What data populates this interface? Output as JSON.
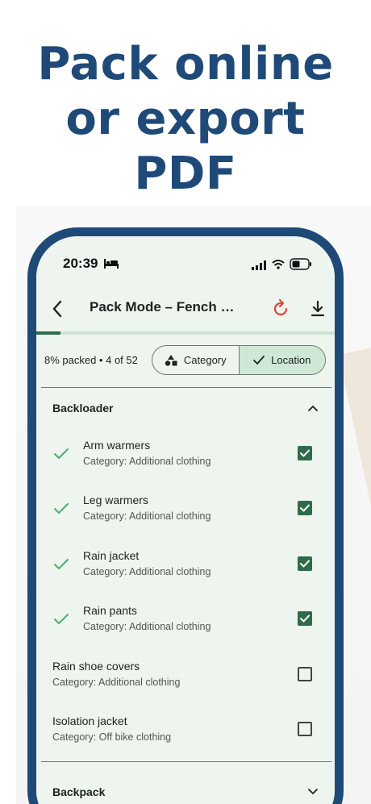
{
  "headline": [
    "Pack online",
    "or export",
    "PDF"
  ],
  "status": {
    "time": "20:39"
  },
  "appbar": {
    "title": "Pack Mode – Fench Di..."
  },
  "progress": {
    "fraction": 0.08
  },
  "toolbar": {
    "packed_text": "8% packed • 4 of 52",
    "seg_category": "Category",
    "seg_location": "Location",
    "active": "Location"
  },
  "sections": [
    {
      "title": "Backloader",
      "expanded": true,
      "items": [
        {
          "name": "Arm warmers",
          "category": "Category: Additional clothing",
          "packed": true
        },
        {
          "name": "Leg warmers",
          "category": "Category: Additional clothing",
          "packed": true
        },
        {
          "name": "Rain jacket",
          "category": "Category: Additional clothing",
          "packed": true
        },
        {
          "name": "Rain pants",
          "category": "Category: Additional clothing",
          "packed": true
        },
        {
          "name": "Rain shoe covers",
          "category": "Category: Additional clothing",
          "packed": false
        },
        {
          "name": "Isolation jacket",
          "category": "Category: Off bike clothing",
          "packed": false
        }
      ]
    },
    {
      "title": "Backpack",
      "expanded": false,
      "items": []
    }
  ],
  "colors": {
    "brand": "#1f4a78",
    "accent": "#2e6b4a",
    "reset": "#e0433a"
  },
  "icons": [
    "bed-icon",
    "signal-icon",
    "wifi-icon",
    "battery-icon",
    "back-arrow-icon",
    "reset-icon",
    "download-icon",
    "shapes-icon",
    "check-icon",
    "chevron-up-icon",
    "chevron-down-icon"
  ]
}
